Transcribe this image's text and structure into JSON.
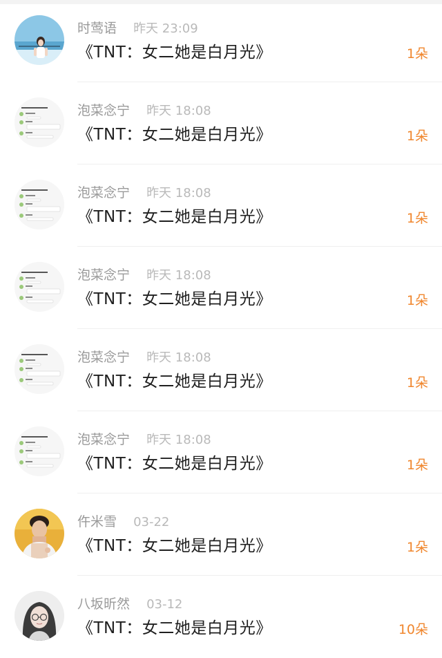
{
  "entries": [
    {
      "name": "时莺语",
      "time": "昨天 23:09",
      "title": "《TNT：女二她是白月光》",
      "count": "1朵",
      "avatar": "beach-girl-avatar"
    },
    {
      "name": "泡菜念宁",
      "time": "昨天 18:08",
      "title": "《TNT：女二她是白月光》",
      "count": "1朵",
      "avatar": "chat-screenshot-avatar"
    },
    {
      "name": "泡菜念宁",
      "time": "昨天 18:08",
      "title": "《TNT：女二她是白月光》",
      "count": "1朵",
      "avatar": "chat-screenshot-avatar"
    },
    {
      "name": "泡菜念宁",
      "time": "昨天 18:08",
      "title": "《TNT：女二她是白月光》",
      "count": "1朵",
      "avatar": "chat-screenshot-avatar"
    },
    {
      "name": "泡菜念宁",
      "time": "昨天 18:08",
      "title": "《TNT：女二她是白月光》",
      "count": "1朵",
      "avatar": "chat-screenshot-avatar"
    },
    {
      "name": "泡菜念宁",
      "time": "昨天 18:08",
      "title": "《TNT：女二她是白月光》",
      "count": "1朵",
      "avatar": "chat-screenshot-avatar"
    },
    {
      "name": "仵米雪",
      "time": "03-22",
      "title": "《TNT：女二她是白月光》",
      "count": "1朵",
      "avatar": "young-man-avatar"
    },
    {
      "name": "八坂昕然",
      "time": "03-12",
      "title": "《TNT：女二她是白月光》",
      "count": "10朵",
      "avatar": "girl-with-glasses-avatar"
    }
  ],
  "colors": {
    "count": "#f0862d",
    "title": "#1f1f1f",
    "meta": "#9a9a9a"
  }
}
